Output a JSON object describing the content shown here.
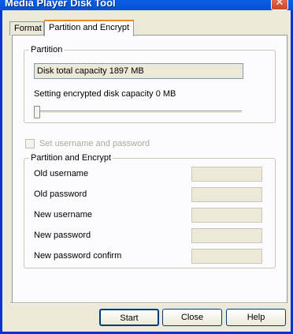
{
  "window": {
    "title": "Media Player Disk Tool",
    "close_glyph": "✕"
  },
  "tabs": [
    {
      "label": "Format",
      "active": false
    },
    {
      "label": "Partition and Encrypt",
      "active": true
    }
  ],
  "partition": {
    "group_title": "Partition",
    "total_capacity_text": "Disk total capacity 1897 MB",
    "encrypted_capacity_label": "Setting encrypted disk capacity 0 MB",
    "slider_level": 0
  },
  "credentials_toggle": {
    "label": "Set username and password",
    "checked": false,
    "enabled": false
  },
  "encrypt": {
    "group_title": "Partition and Encrypt",
    "fields": [
      {
        "label": "Old username",
        "value": ""
      },
      {
        "label": "Old password",
        "value": ""
      },
      {
        "label": "New username",
        "value": ""
      },
      {
        "label": "New password",
        "value": ""
      },
      {
        "label": "New password confirm",
        "value": ""
      }
    ]
  },
  "buttons": {
    "start": "Start",
    "close": "Close",
    "help": "Help"
  },
  "colors": {
    "titlebar": "#0a5fe0",
    "dialog_bg": "#ece9d8",
    "tab_accent": "#e68b2c",
    "close_button": "#c8462a"
  }
}
